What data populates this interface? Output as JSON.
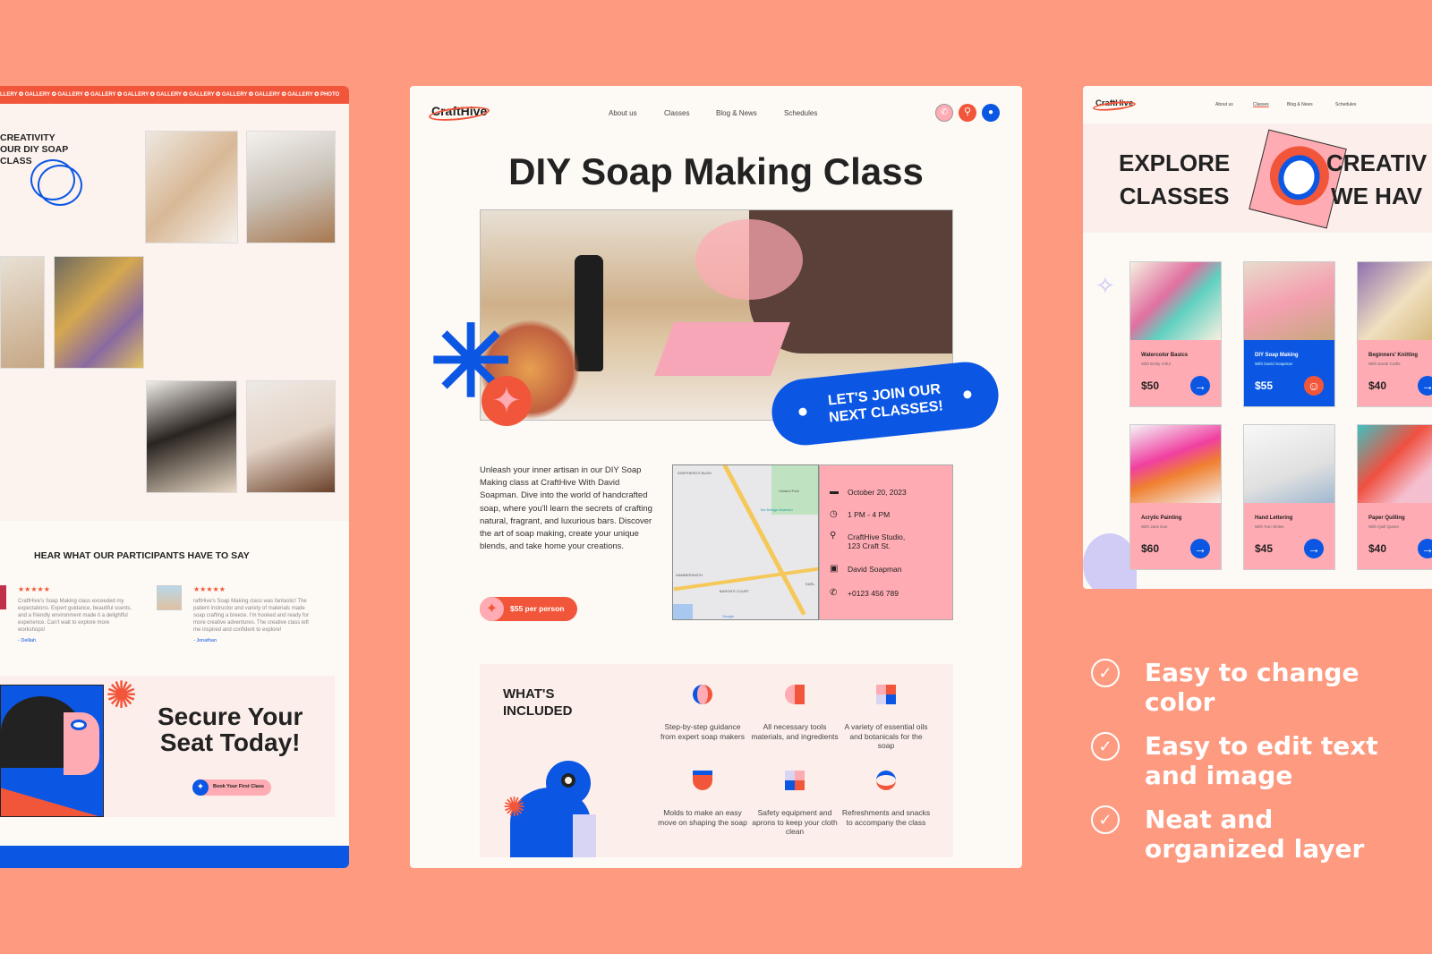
{
  "left_panel": {
    "marquee": "LLERY ✪ GALLERY ✪ GALLERY ✪ GALLERY ✪ GALLERY ✪ GALLERY ✪ GALLERY ✪ GALLERY ✪ GALLERY ✪ GALLERY ✪ PHOTO",
    "hero_lines": [
      "CREATIVITY",
      "OUR DIY SOAP",
      "CLASS"
    ],
    "testimonials_heading": "HEAR WHAT OUR PARTICIPANTS HAVE TO SAY",
    "testimonials": [
      {
        "stars": "★★★★★",
        "text": "CraftHive's Soap Making class exceeded my expectations. Expert guidance, beautiful scents, and a friendly environment made it a delightful experience. Can't wait to explore more workshops!",
        "author": "- Delilah"
      },
      {
        "stars": "★★★★★",
        "text": "raftHive's Soap Making class was fantastic! The patient instructor and variety of materials made soap crafting a breeze. I'm hooked and ready for more creative adventures. The creative class left me inspired and confident to explore!",
        "author": "- Jonathan"
      }
    ],
    "cta_title_1": "Secure Your",
    "cta_title_2": "Seat Today!",
    "cta_button": "Book Your First Class"
  },
  "center_panel": {
    "logo": "CraftHive",
    "nav": [
      "About us",
      "Classes",
      "Blog & News",
      "Schedules"
    ],
    "header_icons": [
      "phone-icon",
      "search-icon",
      "user-icon"
    ],
    "title": "DIY Soap Making Class",
    "banner_line_1": "LET'S JOIN OUR",
    "banner_line_2": "NEXT CLASSES!",
    "description": "Unleash your inner artisan in our DIY Soap Making class at CraftHive With David Soapman. Dive into the world of handcrafted soap, where you'll learn the secrets of crafting natural, fragrant, and luxurious bars. Discover the art of soap making, create your unique blends, and take home your creations.",
    "price_button": "$55 per person",
    "map_labels": [
      "SHEPHERD'S BUSH",
      "Holland Park",
      "the Design Museum",
      "HAMMERSMITH",
      "BARON'S COURT",
      "EARL",
      "Google"
    ],
    "details": {
      "date": "October 20, 2023",
      "time": "1 PM - 4 PM",
      "location_1": "CraftHive Studio,",
      "location_2": "123 Craft St.",
      "instructor": "David Soapman",
      "phone": "+0123 456 789"
    },
    "included_title_1": "WHAT'S",
    "included_title_2": "INCLUDED",
    "included": [
      "Step-by-step guidance from expert soap makers",
      "All necessary tools materials, and ingredients",
      "A variety of essential oils and botanicals for the soap",
      "Molds to make an easy move on shaping the soap",
      "Safety equipment and aprons to keep your cloth clean",
      "Refreshments and snacks to accompany the class"
    ]
  },
  "right_panel": {
    "logo": "CraftHive",
    "nav": [
      "About us",
      "Classes",
      "Blog & News",
      "Schedules"
    ],
    "active_nav": "Classes",
    "hero_left_1": "EXPLORE",
    "hero_left_2": "CLASSES",
    "hero_right_1": "CREATIV",
    "hero_right_2": "WE HAV",
    "cards": [
      {
        "title": "Watercolor Basics",
        "instructor": "With Emily Artful",
        "price": "$50",
        "highlight": false
      },
      {
        "title": "DIY Soap Making",
        "instructor": "With David Soapman",
        "price": "$55",
        "highlight": true
      },
      {
        "title": "Beginners' Knitting",
        "instructor": "With Sarah Crafts",
        "price": "$40",
        "highlight": false
      },
      {
        "title": "Acrylic Painting",
        "instructor": "With Jane Doe",
        "price": "$60",
        "highlight": false
      },
      {
        "title": "Hand Lettering",
        "instructor": "With Tom Writes",
        "price": "$45",
        "highlight": false
      },
      {
        "title": "Paper Quilling",
        "instructor": "With Quill Queen",
        "price": "$40",
        "highlight": false
      }
    ]
  },
  "features": [
    [
      "Easy to change",
      "color"
    ],
    [
      "Easy to edit text",
      "and image"
    ],
    [
      "Neat and",
      "organized layer"
    ]
  ],
  "colors": {
    "background": "#fd9a80",
    "accent_blue": "#0b57e4",
    "accent_orange": "#f2563a",
    "accent_pink": "#ffabb3",
    "panel": "#fdf9f4"
  }
}
